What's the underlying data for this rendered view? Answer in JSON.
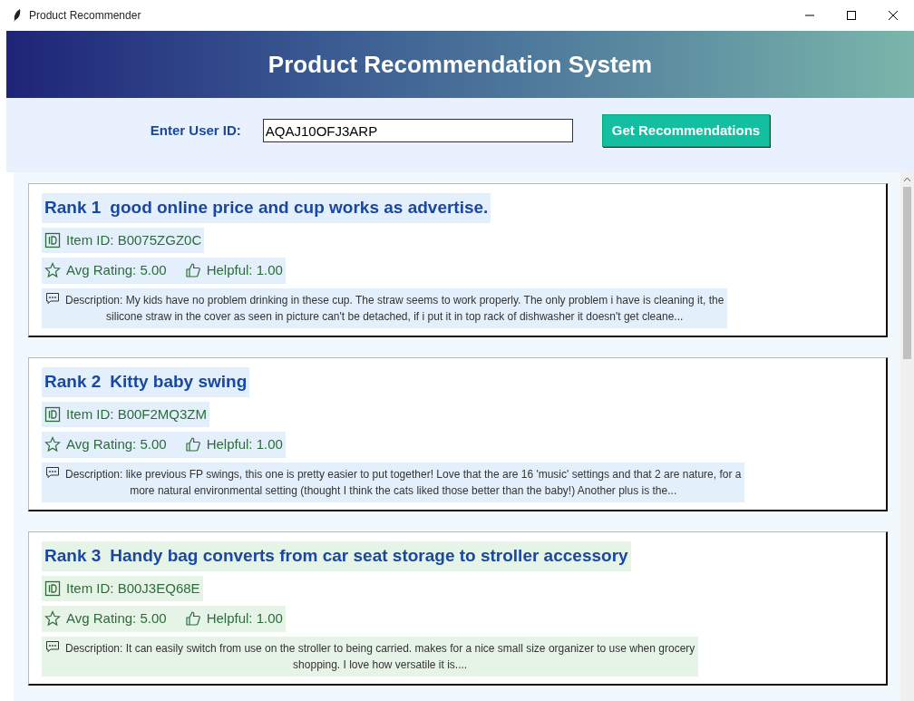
{
  "window": {
    "title": "Product Recommender"
  },
  "header": {
    "title": "Product Recommendation System"
  },
  "form": {
    "label": "Enter User ID:",
    "value": "AQAJ10OFJ3ARP",
    "button": "Get Recommendations"
  },
  "recommendations": [
    {
      "rank": "Rank 1",
      "title": "good online price and cup works as advertise.",
      "item_id": "Item ID: B0075ZGZ0C",
      "rating": "Avg Rating: 5.00",
      "helpful": "Helpful: 1.00",
      "color": "#e3f0fc",
      "description_lines": [
        "Description: My kids have no problem drinking in these cup. The straw seems to work properly. The only problem i have is cleaning it, the",
        "silicone straw in the cover as seen in picture can't be detached, if i put it in top rack of dishwasher it doesn't get cleane..."
      ]
    },
    {
      "rank": "Rank 2",
      "title": "Kitty baby swing",
      "item_id": "Item ID: B00F2MQ3ZM",
      "rating": "Avg Rating: 5.00",
      "helpful": "Helpful: 1.00",
      "color": "#e3f0fc",
      "description_lines": [
        "Description: like previous FP swings, this one is pretty easier to put together! Love that the are 16 'music' settings and that 2 are nature, for a",
        "more natural environmental setting (thought I think the cats liked those better than the baby!) Another plus is the..."
      ]
    },
    {
      "rank": "Rank 3",
      "title": "Handy bag converts from car seat storage to stroller accessory",
      "item_id": "Item ID: B00J3EQ68E",
      "rating": "Avg Rating: 5.00",
      "helpful": "Helpful: 1.00",
      "color": "#e6f4e8",
      "description_lines": [
        "Description: It can easily switch from use on the stroller to being carried.  makes for a nice small size organizer to use when grocery",
        "shopping.  I love how versatile it is...."
      ]
    }
  ]
}
